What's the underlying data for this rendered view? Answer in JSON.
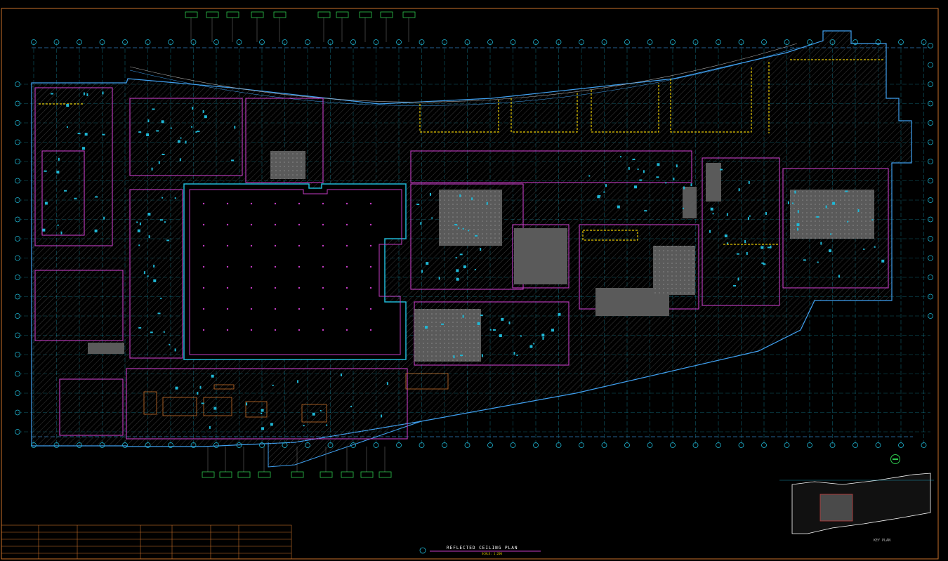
{
  "sheet": {
    "title": "REFLECTED CEILING PLAN",
    "scale": "SCALE: 1:200",
    "key_plan_label": "KEY PLAN"
  },
  "colors": {
    "background": "#000000",
    "border": "#c8702a",
    "grid": "#1fb8d6",
    "walls": "#c43cc4",
    "ceiling_fill": "#555555",
    "lighting": "#e6c800",
    "exterior": "#3fa0f0",
    "north_arrow": "#2ec94e"
  },
  "icons": [
    "north-arrow-icon",
    "grid-bubble-icon",
    "section-tag-icon"
  ]
}
